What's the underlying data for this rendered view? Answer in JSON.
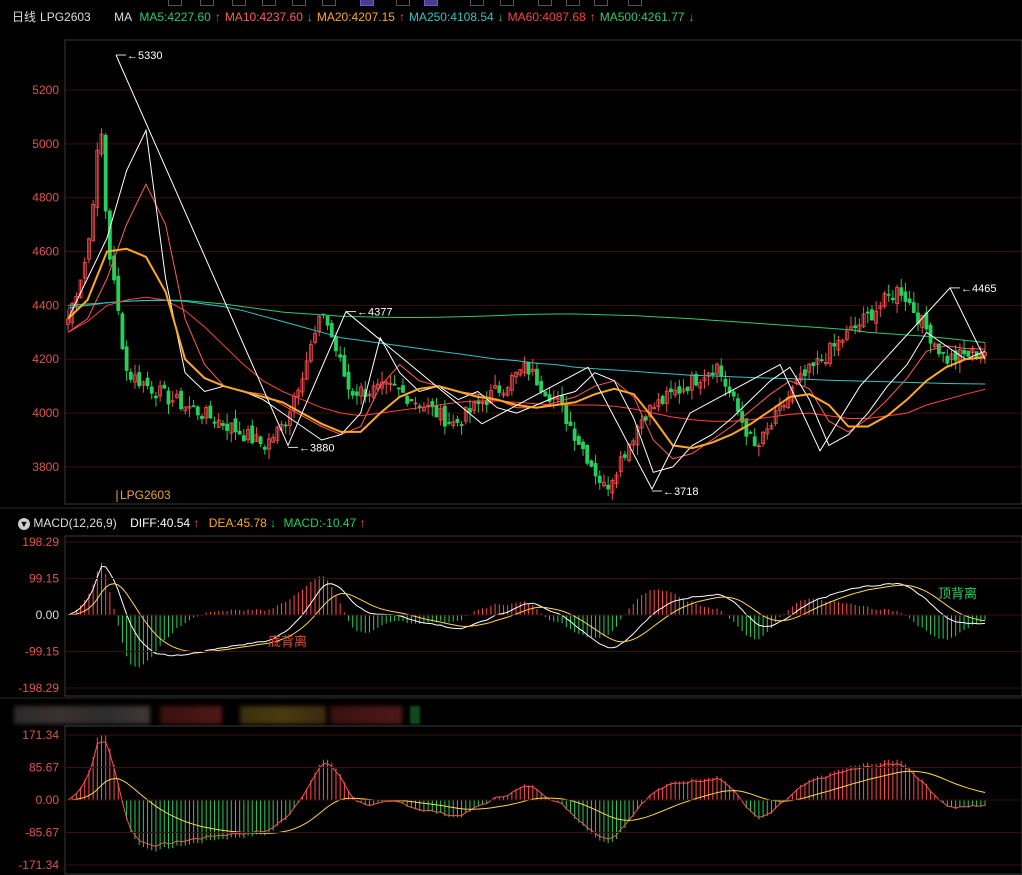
{
  "header": {
    "period": "日线",
    "symbol": "LPG2603",
    "ma_label": "MA",
    "ma_lines": [
      {
        "label": "MA5:4227.60",
        "color": "#ffffff",
        "arrow": "↑",
        "dir": "up"
      },
      {
        "label": "MA10:4237.60",
        "color": "#ff5a5a",
        "arrow": "↓",
        "dir": "down"
      },
      {
        "label": "MA20:4207.15",
        "color": "#ffa726",
        "arrow": "↑",
        "dir": "up"
      },
      {
        "label": "MA250:4108.54",
        "color": "#2ec4c4",
        "arrow": "↓",
        "dir": "down"
      },
      {
        "label": "MA60:4087.68",
        "color": "#ff4040",
        "arrow": "↑",
        "dir": "up"
      },
      {
        "label": "MA500:4261.77",
        "color": "#33c86b",
        "arrow": "↓",
        "dir": "down"
      }
    ]
  },
  "price_axis": {
    "ticks": [
      "5200",
      "5000",
      "4800",
      "4600",
      "4400",
      "4200",
      "4000",
      "3800"
    ]
  },
  "annotations": {
    "peak": "5330",
    "low1": "3880",
    "high2": "4377",
    "low2": "3718",
    "high3": "4465",
    "contract_tag": "LPG2603"
  },
  "macd": {
    "title": "MACD(12,26,9)",
    "diff": "DIFF:40.54",
    "dea": "DEA:45.78",
    "macd": "MACD:-10.47",
    "diff_arrow": "↑",
    "dea_arrow": "↓",
    "macd_arrow": "↑",
    "ticks": [
      "198.29",
      "99.15",
      "0.00",
      "-99.15",
      "-198.29"
    ],
    "bottom_divergence": "底背离",
    "top_divergence": "顶背离"
  },
  "third_panel": {
    "ticks": [
      "171.34",
      "85.67",
      "0.00",
      "-85.67",
      "-171.34"
    ]
  },
  "colors": {
    "up": "#ff4d4d",
    "down": "#25d05a",
    "grid": "#3a0f0f",
    "ma5": "#ffffff",
    "ma10": "#ff5a5a",
    "ma20": "#ffa726",
    "ma250": "#2ec4c4",
    "ma60": "#ff4040",
    "ma500": "#33c86b"
  },
  "chart_data": {
    "type": "candlestick",
    "ylim": [
      3650,
      5420
    ],
    "grid": true,
    "zigzag": [
      5330,
      3880,
      4377,
      3960,
      4170,
      3718,
      4000,
      4180,
      3860,
      4100,
      4465,
      4200
    ],
    "ma5": [
      4350,
      4500,
      4650,
      4900,
      5050,
      4500,
      4150,
      4080,
      4100,
      4080,
      4050,
      4000,
      3950,
      3900,
      3920,
      4000,
      4280,
      4150,
      4080,
      4100,
      4050,
      4080,
      4020,
      4000,
      4030,
      4060,
      4080,
      4150,
      4120,
      3980,
      3780,
      3800,
      3880,
      3920,
      3980,
      4050,
      4120,
      4170,
      4050,
      3880,
      3920,
      4000,
      4100,
      4180,
      4300,
      4250,
      4200,
      4230
    ],
    "ma10": [
      4300,
      4350,
      4500,
      4700,
      4850,
      4700,
      4350,
      4180,
      4100,
      4080,
      4070,
      4030,
      3990,
      3950,
      3920,
      3950,
      4100,
      4180,
      4120,
      4100,
      4080,
      4070,
      4050,
      4020,
      4020,
      4040,
      4060,
      4100,
      4120,
      4060,
      3900,
      3830,
      3850,
      3900,
      3950,
      4010,
      4070,
      4120,
      4090,
      3970,
      3930,
      3980,
      4050,
      4130,
      4230,
      4250,
      4240,
      4237
    ],
    "ma20": [
      4350,
      4420,
      4600,
      4610,
      4580,
      4450,
      4200,
      4130,
      4100,
      4080,
      4060,
      4040,
      4000,
      3960,
      3930,
      3930,
      4000,
      4060,
      4090,
      4100,
      4080,
      4060,
      4050,
      4030,
      4020,
      4030,
      4040,
      4070,
      4090,
      4070,
      3980,
      3880,
      3870,
      3890,
      3920,
      3960,
      4010,
      4060,
      4070,
      4030,
      3950,
      3950,
      3990,
      4050,
      4120,
      4170,
      4200,
      4207
    ],
    "ma60": [
      4300,
      4340,
      4400,
      4420,
      4430,
      4420,
      4380,
      4320,
      4250,
      4180,
      4120,
      4080,
      4050,
      4020,
      4000,
      3990,
      4000,
      4010,
      4020,
      4030,
      4040,
      4045,
      4045,
      4040,
      4035,
      4030,
      4030,
      4030,
      4025,
      4015,
      4000,
      3985,
      3975,
      3970,
      3970,
      3975,
      3985,
      3995,
      4000,
      3990,
      3980,
      3980,
      3990,
      4000,
      4030,
      4050,
      4070,
      4088
    ],
    "ma250": [
      4390,
      4400,
      4410,
      4415,
      4418,
      4418,
      4415,
      4405,
      4395,
      4380,
      4360,
      4340,
      4320,
      4300,
      4280,
      4270,
      4260,
      4250,
      4240,
      4230,
      4220,
      4210,
      4200,
      4195,
      4185,
      4180,
      4170,
      4165,
      4160,
      4155,
      4150,
      4145,
      4140,
      4138,
      4135,
      4132,
      4130,
      4128,
      4125,
      4122,
      4120,
      4118,
      4116,
      4114,
      4112,
      4110,
      4109,
      4108
    ],
    "ma500": [
      4400,
      4405,
      4410,
      4415,
      4418,
      4420,
      4418,
      4412,
      4405,
      4395,
      4385,
      4375,
      4370,
      4365,
      4360,
      4358,
      4356,
      4355,
      4355,
      4356,
      4358,
      4360,
      4362,
      4365,
      4367,
      4368,
      4368,
      4366,
      4364,
      4362,
      4358,
      4354,
      4350,
      4345,
      4340,
      4335,
      4330,
      4325,
      4320,
      4315,
      4310,
      4300,
      4295,
      4290,
      4285,
      4278,
      4270,
      4262
    ]
  }
}
